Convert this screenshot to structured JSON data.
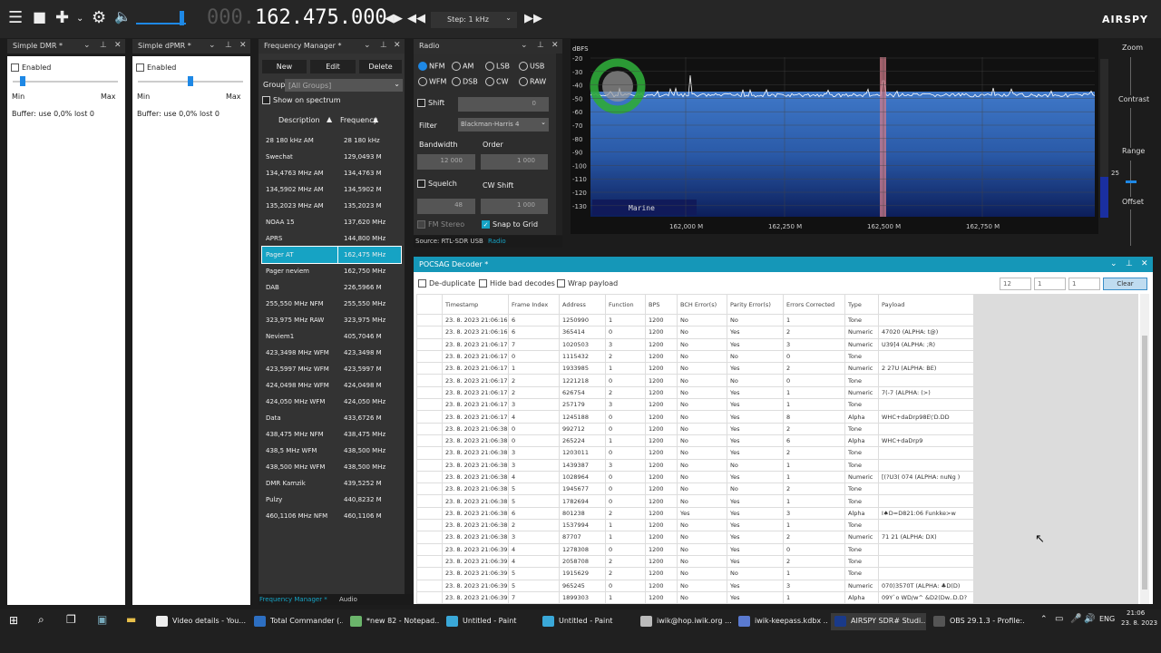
{
  "topbar": {
    "freq_dim": "000.",
    "freq_main": "162.475.000",
    "step": "Step: 1 kHz",
    "logo": "AIRSPY"
  },
  "dmr": {
    "title": "Simple DMR *",
    "enabled": "Enabled",
    "min": "Min",
    "max": "Max",
    "buffer": "Buffer: use 0,0% lost 0"
  },
  "dpmr": {
    "title": "Simple dPMR *",
    "enabled": "Enabled",
    "min": "Min",
    "max": "Max",
    "buffer": "Buffer: use 0,0% lost 0"
  },
  "fm": {
    "title": "Frequency Manager *",
    "new": "New",
    "edit": "Edit",
    "delete": "Delete",
    "group_label": "Group:",
    "group_value": "[All Groups]",
    "show_spectrum": "Show on spectrum",
    "col_desc": "Description",
    "col_freq": "Frequency",
    "tab1": "Frequency Manager *",
    "tab2": "Audio",
    "rows": [
      [
        "28 180 kHz AM",
        "28 180 kHz"
      ],
      [
        "Swechat",
        "129,0493 M"
      ],
      [
        "134,4763 MHz AM",
        "134,4763 M"
      ],
      [
        "134,5902 MHz AM",
        "134,5902 M"
      ],
      [
        "135,2023 MHz AM",
        "135,2023 M"
      ],
      [
        "NOAA 15",
        "137,620 MHz"
      ],
      [
        "APRS",
        "144,800 MHz"
      ],
      [
        "Pager AT",
        "162,475 MHz"
      ],
      [
        "Pager neviem",
        "162,750 MHz"
      ],
      [
        "DAB",
        "226,5966 M"
      ],
      [
        "255,550 MHz NFM",
        "255,550 MHz"
      ],
      [
        "323,975 MHz RAW",
        "323,975 MHz"
      ],
      [
        "Neviem1",
        "405,7046 M"
      ],
      [
        "423,3498 MHz WFM",
        "423,3498 M"
      ],
      [
        "423,5997 MHz WFM",
        "423,5997 M"
      ],
      [
        "424,0498 MHz WFM",
        "424,0498 M"
      ],
      [
        "424,050 MHz WFM",
        "424,050 MHz"
      ],
      [
        "Data",
        "433,6726 M"
      ],
      [
        "438,475 MHz NFM",
        "438,475 MHz"
      ],
      [
        "438,5 MHz WFM",
        "438,500 MHz"
      ],
      [
        "438,500 MHz WFM",
        "438,500 MHz"
      ],
      [
        "DMR Kamzik",
        "439,5252 M"
      ],
      [
        "Pulzy",
        "440,8232 M"
      ],
      [
        "460,1106 MHz NFM",
        "460,1106 M"
      ]
    ]
  },
  "radio": {
    "title": "Radio",
    "modes": [
      "NFM",
      "AM",
      "LSB",
      "USB",
      "WFM",
      "DSB",
      "CW",
      "RAW"
    ],
    "shift": "Shift",
    "shift_val": "0",
    "filter": "Filter",
    "filter_val": "Blackman-Harris 4",
    "bandwidth": "Bandwidth",
    "order": "Order",
    "bw_val": "12 000",
    "order_val": "1 000",
    "squelch": "Squelch",
    "cwshift": "CW Shift",
    "sq_val": "48",
    "cw_val": "1 000",
    "fmstereo": "FM Stereo",
    "snap": "Snap to Grid",
    "source": "Source: RTL-SDR USB",
    "radio_tab": "Radio"
  },
  "spectrum": {
    "unit": "dBFS",
    "db_ticks": [
      "-20",
      "-30",
      "-40",
      "-50",
      "-60",
      "-70",
      "-80",
      "-90",
      "-100",
      "-110",
      "-120",
      "-130"
    ],
    "freq_ticks": [
      "162,000 M",
      "162,250 M",
      "162,500 M",
      "162,750 M"
    ],
    "band_label": "Marine",
    "zoom": "Zoom",
    "contrast": "Contrast",
    "range": "Range",
    "range_val": "25",
    "offset": "Offset"
  },
  "pocsag": {
    "title": "POCSAG Decoder *",
    "dedup": "De-duplicate",
    "hidebad": "Hide bad decodes",
    "wrap": "Wrap payload",
    "n1": "12",
    "n2": "1",
    "n3": "1",
    "clear": "Clear",
    "headers": [
      "Timestamp",
      "Frame Index",
      "Address",
      "Function",
      "BPS",
      "BCH Error(s)",
      "Parity Error(s)",
      "Errors Corrected",
      "Type",
      "Payload"
    ],
    "rows": [
      [
        "23. 8. 2023 21:06:16",
        "6",
        "1250990",
        "1",
        "1200",
        "No",
        "No",
        "1",
        "Tone",
        ""
      ],
      [
        "23. 8. 2023 21:06:16",
        "6",
        "365414",
        "0",
        "1200",
        "No",
        "Yes",
        "2",
        "Numeric",
        "47020 (ALPHA: t@)"
      ],
      [
        "23. 8. 2023 21:06:17",
        "7",
        "1020503",
        "3",
        "1200",
        "No",
        "Yes",
        "3",
        "Numeric",
        "U39]4 (ALPHA: ;R)"
      ],
      [
        "23. 8. 2023 21:06:17",
        "0",
        "1115432",
        "2",
        "1200",
        "No",
        "No",
        "0",
        "Tone",
        ""
      ],
      [
        "23. 8. 2023 21:06:17",
        "1",
        "1933985",
        "1",
        "1200",
        "No",
        "Yes",
        "2",
        "Numeric",
        "2 27U (ALPHA: BE)"
      ],
      [
        "23. 8. 2023 21:06:17",
        "2",
        "1221218",
        "0",
        "1200",
        "No",
        "No",
        "0",
        "Tone",
        ""
      ],
      [
        "23. 8. 2023 21:06:17",
        "2",
        "626754",
        "2",
        "1200",
        "No",
        "Yes",
        "1",
        "Numeric",
        " 7(-7 (ALPHA: (>)"
      ],
      [
        "23. 8. 2023 21:06:17",
        "3",
        "257179",
        "3",
        "1200",
        "No",
        "Yes",
        "1",
        "Tone",
        ""
      ],
      [
        "23. 8. 2023 21:06:17",
        "4",
        "1245188",
        "0",
        "1200",
        "No",
        "Yes",
        "8",
        "Alpha",
        "WHC+daDrp98E\\'D.DD"
      ],
      [
        "23. 8. 2023 21:06:38",
        "0",
        "992712",
        "0",
        "1200",
        "No",
        "Yes",
        "2",
        "Tone",
        ""
      ],
      [
        "23. 8. 2023 21:06:38",
        "0",
        "265224",
        "1",
        "1200",
        "No",
        "Yes",
        "6",
        "Alpha",
        "WHC+daDrp9"
      ],
      [
        "23. 8. 2023 21:06:38",
        "3",
        "1203011",
        "0",
        "1200",
        "No",
        "Yes",
        "2",
        "Tone",
        ""
      ],
      [
        "23. 8. 2023 21:06:38",
        "3",
        "1439387",
        "3",
        "1200",
        "No",
        "No",
        "1",
        "Tone",
        ""
      ],
      [
        "23. 8. 2023 21:06:38",
        "4",
        "1028964",
        "0",
        "1200",
        "No",
        "Yes",
        "1",
        "Numeric",
        "[(?U3( 074 (ALPHA: nuNg )"
      ],
      [
        "23. 8. 2023 21:06:38",
        "5",
        "1945677",
        "0",
        "1200",
        "No",
        "No",
        "2",
        "Tone",
        ""
      ],
      [
        "23. 8. 2023 21:06:38",
        "5",
        "1782694",
        "0",
        "1200",
        "No",
        "Yes",
        "1",
        "Tone",
        ""
      ],
      [
        "23. 8. 2023 21:06:38",
        "6",
        "801238",
        "2",
        "1200",
        "Yes",
        "Yes",
        "3",
        "Alpha",
        "I♠D=D821:06 Funkke>w"
      ],
      [
        "23. 8. 2023 21:06:38",
        "2",
        "1537994",
        "1",
        "1200",
        "No",
        "Yes",
        "1",
        "Tone",
        ""
      ],
      [
        "23. 8. 2023 21:06:38",
        "3",
        "87707",
        "1",
        "1200",
        "No",
        "Yes",
        "2",
        "Numeric",
        "71 21 (ALPHA: DX)"
      ],
      [
        "23. 8. 2023 21:06:39",
        "4",
        "1278308",
        "0",
        "1200",
        "No",
        "Yes",
        "0",
        "Tone",
        ""
      ],
      [
        "23. 8. 2023 21:06:39",
        "4",
        "2058708",
        "2",
        "1200",
        "No",
        "Yes",
        "2",
        "Tone",
        ""
      ],
      [
        "23. 8. 2023 21:06:39",
        "5",
        "1915629",
        "2",
        "1200",
        "No",
        "No",
        "1",
        "Tone",
        ""
      ],
      [
        "23. 8. 2023 21:06:39",
        "5",
        "965245",
        "0",
        "1200",
        "No",
        "Yes",
        "3",
        "Numeric",
        " 070)3570T (ALPHA: ♣D(D)"
      ],
      [
        "23. 8. 2023 21:06:39",
        "7",
        "1899303",
        "1",
        "1200",
        "No",
        "Yes",
        "1",
        "Alpha",
        "09Y`o WD/w^ &D2(Dw..D.D?"
      ]
    ]
  },
  "taskbar": {
    "items": [
      "Video details - You...",
      "Total Commander (...",
      "*new 82 - Notepad...",
      "Untitled - Paint",
      "Untitled - Paint",
      "iwik@hop.iwik.org ...",
      "iwik-keepass.kdbx ...",
      "AIRSPY SDR# Studi...",
      "OBS 29.1.3 - Profile:..."
    ],
    "lang": "ENG",
    "time": "21:06",
    "date": "23. 8. 2023"
  }
}
